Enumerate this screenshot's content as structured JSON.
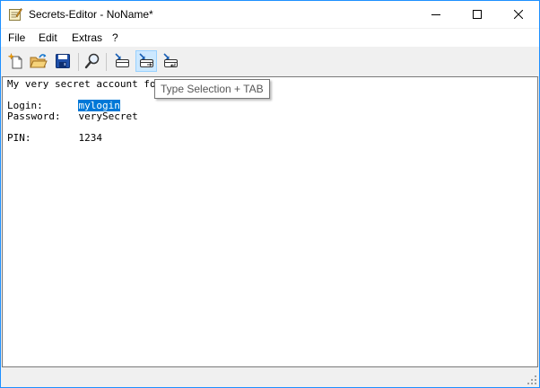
{
  "window": {
    "title": "Secrets-Editor - NoName*",
    "accent_color": "#1e90ff"
  },
  "menu": {
    "items": [
      "File",
      "Edit",
      "Extras",
      "?"
    ]
  },
  "toolbar": {
    "buttons": [
      {
        "name": "new-file",
        "icon": "new-document-sparkle-icon"
      },
      {
        "name": "open-file",
        "icon": "open-folder-icon"
      },
      {
        "name": "save-file",
        "icon": "save-disk-icon"
      },
      {
        "name": "find",
        "icon": "magnifier-icon"
      },
      {
        "name": "type-selection",
        "icon": "type-selection-icon"
      },
      {
        "name": "type-selection-tab",
        "icon": "type-selection-tab-icon",
        "hovered": true
      },
      {
        "name": "type-selection-enter",
        "icon": "type-selection-enter-icon"
      }
    ]
  },
  "editor": {
    "line1": "My very secret account for",
    "login_label": "Login:      ",
    "login_value": "mylogin",
    "password_line": "Password:   verySecret",
    "pin_line": "PIN:        1234",
    "selection_color": "#0078d7"
  },
  "tooltip": {
    "text": "Type Selection + TAB"
  }
}
